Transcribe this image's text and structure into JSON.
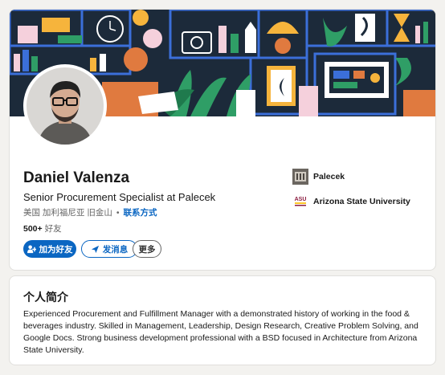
{
  "profile": {
    "name": "Daniel Valenza",
    "headline": "Senior Procurement Specialist at Palecek",
    "location": "美国 加利福尼亚 旧金山",
    "separator": "•",
    "contact_info_label": "联系方式",
    "connections_count": "500+",
    "connections_label": "好友"
  },
  "actions": {
    "add_friend_label": "加为好友",
    "message_label": "发消息",
    "more_label": "更多"
  },
  "experience": {
    "company_name": "Palecek",
    "school_name": "Arizona State University",
    "school_logo_text": "ASU"
  },
  "about": {
    "title": "个人简介",
    "text": "Experienced Procurement and Fulfillment Manager with a demonstrated history of working in the food & beverages industry. Skilled in Management, Leadership, Design Research, Creative Problem Solving, and Google Docs. Strong business development professional with a BSD focused in Architecture from Arizona State University."
  },
  "colors": {
    "accent": "#0a66c2",
    "banner_bg": "#1c2a3a"
  }
}
